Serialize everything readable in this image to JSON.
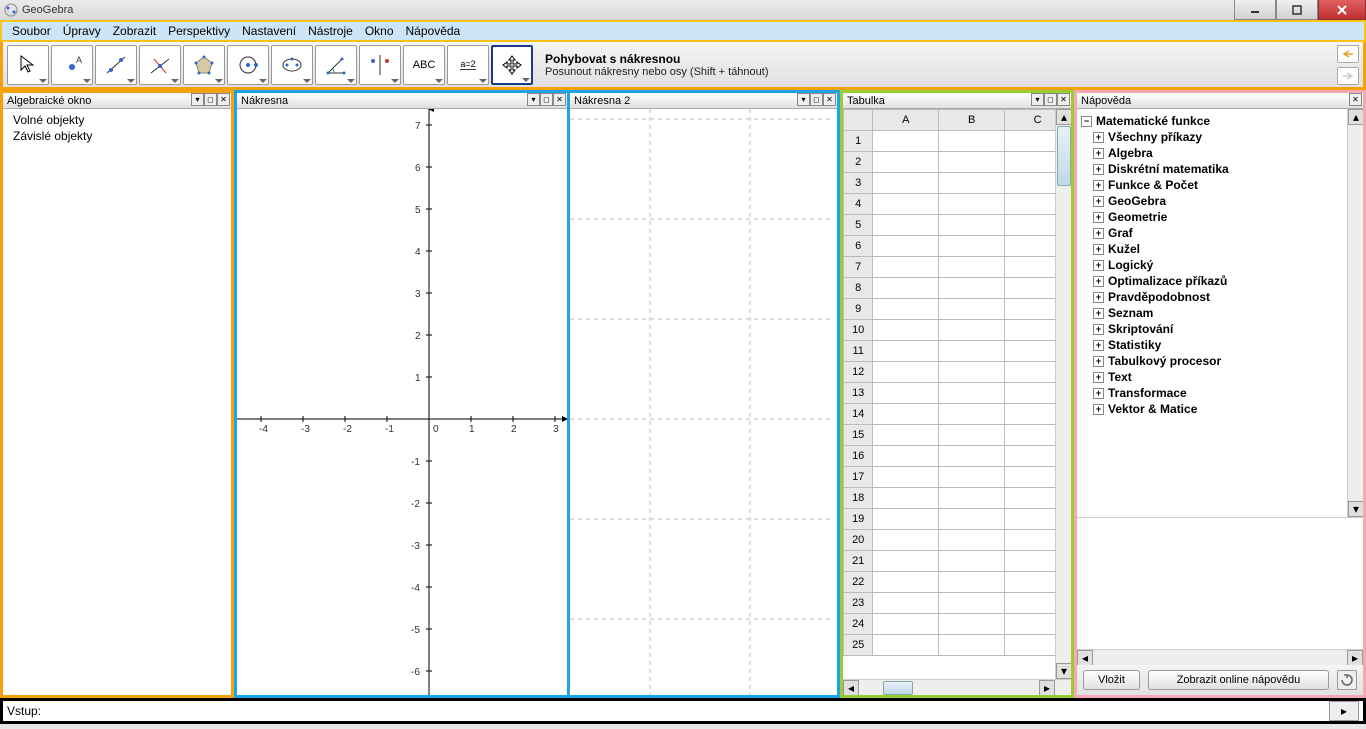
{
  "window": {
    "title": "GeoGebra"
  },
  "menu": {
    "items": [
      "Soubor",
      "Úpravy",
      "Zobrazit",
      "Perspektivy",
      "Nastavení",
      "Nástroje",
      "Okno",
      "Nápověda"
    ]
  },
  "toolbar": {
    "selected_tool_title": "Pohybovat s nákresnou",
    "selected_tool_hint": "Posunout nákresny nebo osy (Shift + táhnout)",
    "tools": [
      {
        "name": "move",
        "label": "Ukazovátko"
      },
      {
        "name": "point",
        "label": "Nový bod"
      },
      {
        "name": "line",
        "label": "Přímka"
      },
      {
        "name": "perpendicular",
        "label": "Kolmice"
      },
      {
        "name": "polygon",
        "label": "Mnohoúhelník"
      },
      {
        "name": "circle",
        "label": "Kružnice"
      },
      {
        "name": "ellipse",
        "label": "Kuželosečka"
      },
      {
        "name": "angle",
        "label": "Úhel"
      },
      {
        "name": "reflect",
        "label": "Zrcadlení"
      },
      {
        "name": "text",
        "label": "Text",
        "text": "ABC"
      },
      {
        "name": "slider",
        "label": "Posuvník",
        "text": "a=2"
      },
      {
        "name": "move-view",
        "label": "Pohybovat s nákresnou",
        "selected": true
      }
    ]
  },
  "panels": {
    "algebra": {
      "title": "Algebraické okno",
      "free_objects": "Volné objekty",
      "dependent_objects": "Závislé objekty"
    },
    "graphics": {
      "title": "Nákresna",
      "x_ticks": [
        -4,
        -3,
        -2,
        -1,
        0,
        1,
        2,
        3
      ],
      "y_ticks": [
        7,
        6,
        5,
        4,
        3,
        2,
        1,
        -1,
        -2,
        -3,
        -4,
        -5,
        -6
      ]
    },
    "graphics2": {
      "title": "Nákresna 2"
    },
    "spreadsheet": {
      "title": "Tabulka",
      "columns": [
        "A",
        "B",
        "C"
      ],
      "row_count": 25
    },
    "help": {
      "title": "Nápověda",
      "root": "Matematické funkce",
      "categories": [
        "Všechny příkazy",
        "Algebra",
        "Diskrétní matematika",
        "Funkce & Počet",
        "GeoGebra",
        "Geometrie",
        "Graf",
        "Kužel",
        "Logický",
        "Optimalizace příkazů",
        "Pravděpodobnost",
        "Seznam",
        "Skriptování",
        "Statistiky",
        "Tabulkový procesor",
        "Text",
        "Transformace",
        "Vektor & Matice"
      ],
      "insert_btn": "Vložit",
      "online_help_btn": "Zobrazit online nápovědu"
    }
  },
  "inputbar": {
    "label": "Vstup:",
    "value": ""
  }
}
